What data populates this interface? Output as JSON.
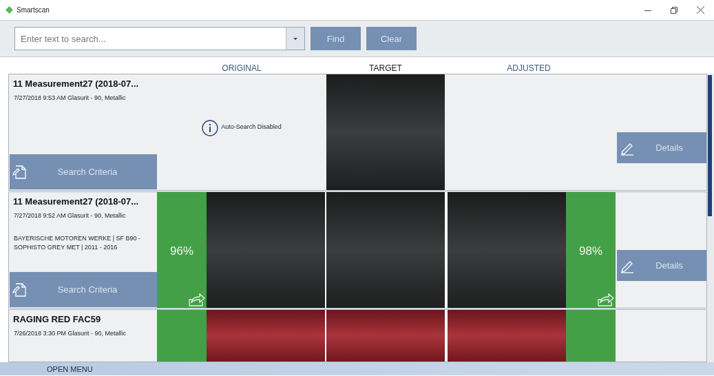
{
  "window": {
    "title": "Smartscan"
  },
  "search": {
    "placeholder": "Enter text to search..."
  },
  "buttons": [
    {
      "label": "Find"
    },
    {
      "label": "Clear"
    }
  ],
  "columns": [
    "ORIGINAL",
    "TARGET",
    "ADJUSTED"
  ],
  "rows": [
    {
      "title": "11 Measurement27 (2018-07...",
      "subtitle": "7/27/2018 9:53 AM  Glasurit - 90, Metallic",
      "criteria_button": "Search Criteria",
      "color": "#2b2c2d",
      "original": {
        "kind": "notice",
        "text": "Auto-Search Disabled"
      },
      "adjusted": {
        "kind": "empty"
      },
      "details_button": "Details"
    },
    {
      "title": "11 Measurement27 (2018-07...",
      "subtitle": "7/27/2018 9:52 AM  Glasurit - 90, Metallic",
      "description": "BAYERISCHE MOTOREN WERKE  |  SF B90  - SOPHISTO GREY MET  |  2011 - 2016",
      "criteria_button": "Search Criteria",
      "color": "#2b2c2d",
      "original": {
        "kind": "match",
        "score": "96%"
      },
      "adjusted": {
        "kind": "match",
        "score": "98%"
      },
      "details_button": "Details"
    },
    {
      "title": "RAGING RED FAC59",
      "subtitle": "7/26/2018 3:30 PM  Glasurit - 90, Metallic",
      "color": "#a3222b",
      "original": {
        "kind": "match"
      },
      "adjusted": {
        "kind": "match"
      }
    }
  ],
  "footer": {
    "label": "OPEN MENU"
  }
}
